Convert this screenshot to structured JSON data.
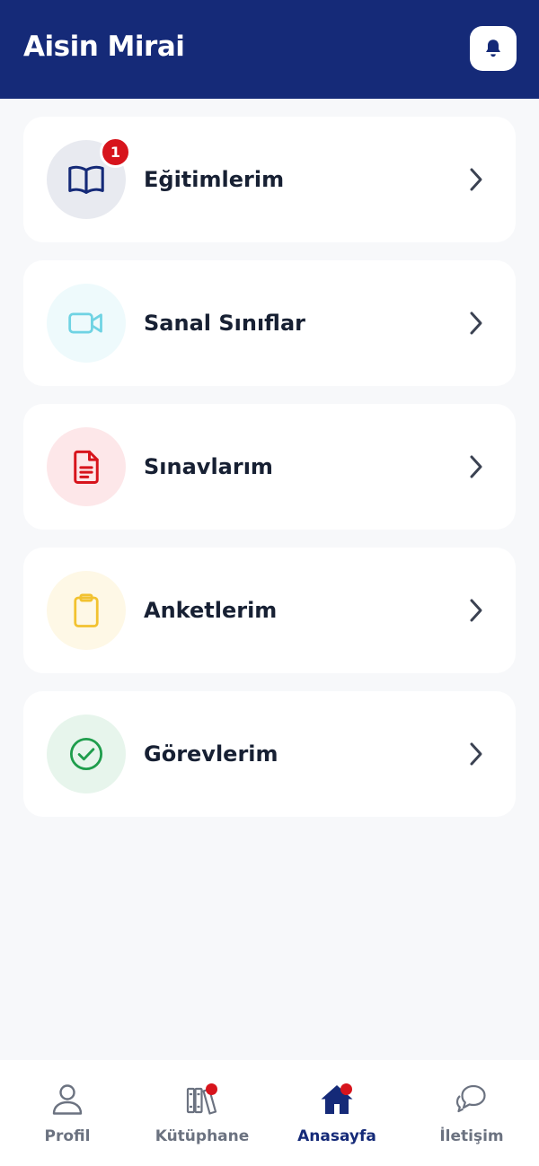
{
  "header": {
    "title": "Aisin Mirai",
    "notification_icon": "bell-icon"
  },
  "menu": {
    "items": [
      {
        "label": "Eğitimlerim",
        "icon": "book-open-icon",
        "badge": "1",
        "color": "#152a78",
        "bg": "#e8eaf0"
      },
      {
        "label": "Sanal Sınıflar",
        "icon": "video-camera-icon",
        "color": "#6fd3e3",
        "bg": "#eefafc"
      },
      {
        "label": "Sınavlarım",
        "icon": "document-icon",
        "color": "#d7141c",
        "bg": "#fde7e9"
      },
      {
        "label": "Anketlerim",
        "icon": "clipboard-icon",
        "color": "#f2c230",
        "bg": "#fef8e6"
      },
      {
        "label": "Görevlerim",
        "icon": "check-circle-icon",
        "color": "#1f9d4c",
        "bg": "#e7f5ec"
      }
    ]
  },
  "bottom_nav": {
    "items": [
      {
        "label": "Profil",
        "icon": "user-icon",
        "active": false
      },
      {
        "label": "Kütüphane",
        "icon": "library-icon",
        "active": false,
        "dot": true
      },
      {
        "label": "Anasayfa",
        "icon": "home-icon",
        "active": true,
        "dot": true
      },
      {
        "label": "İletişim",
        "icon": "chat-icon",
        "active": false
      }
    ]
  },
  "colors": {
    "primary": "#152a78",
    "background": "#f7f8fa",
    "badge": "#d7141c",
    "text": "#172033",
    "muted": "#6b7280"
  }
}
